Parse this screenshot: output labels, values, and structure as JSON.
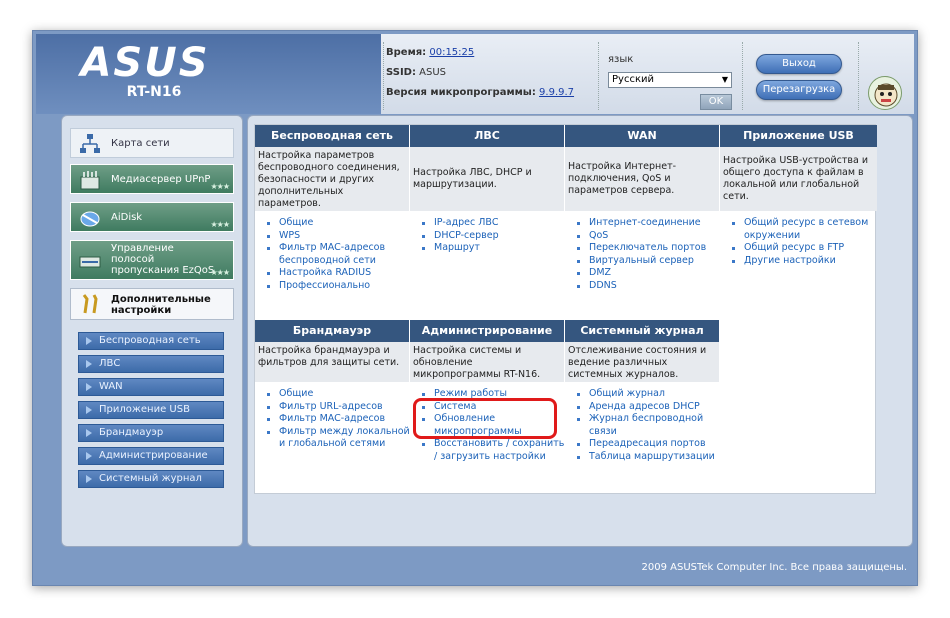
{
  "header": {
    "brand": "ASUS",
    "model": "RT-N16",
    "time_label": "Время:",
    "time_value": "00:15:25",
    "ssid_label": "SSID:",
    "ssid_value": "ASUS",
    "firmware_label": "Версия микропрограммы:",
    "firmware_value": "9.9.9.7",
    "lang_label": "язык",
    "lang_selected": "Русский",
    "ok_label": "OK",
    "logout_label": "Выход",
    "reboot_label": "Перезагрузка"
  },
  "sidebar": {
    "main_items": [
      {
        "label": "Карта сети",
        "icon": "network-map-icon"
      },
      {
        "label": "Медиасервер UPnP",
        "icon": "media-server-icon"
      },
      {
        "label": "AiDisk",
        "icon": "aidisk-icon"
      },
      {
        "label": "Управление полосой пропускания EzQoS",
        "line1": "Управление",
        "line2": "полосой",
        "line3": "пропускания EzQoS",
        "icon": "ezqos-icon"
      },
      {
        "label": "Дополнительные настройки",
        "line1": "Дополнительные",
        "line2": "настройки",
        "icon": "tools-icon"
      }
    ],
    "sub_items": [
      "Беспроводная сеть",
      "ЛВС",
      "WAN",
      "Приложение USB",
      "Брандмауэр",
      "Администрирование",
      "Системный журнал"
    ]
  },
  "sections": [
    {
      "title": "Беспроводная сеть",
      "desc": "Настройка параметров беспроводного соединения, безопасности и других дополнительных параметров.",
      "links": [
        "Общие",
        "WPS",
        "Фильтр MAC-адресов беспроводной сети",
        "Настройка RADIUS",
        "Профессионально"
      ]
    },
    {
      "title": "ЛВС",
      "desc": "Настройка ЛВС, DHCP и маршрутизации.",
      "links": [
        "IP-адрес ЛВС",
        "DHCP-сервер",
        "Маршрут"
      ]
    },
    {
      "title": "WAN",
      "desc": "Настройка Интернет-подключения, QoS и параметров сервера.",
      "links": [
        "Интернет-соединение",
        "QoS",
        "Переключатель портов",
        "Виртуальный сервер",
        "DMZ",
        "DDNS"
      ]
    },
    {
      "title": "Приложение USB",
      "desc": "Настройка USB-устройства и общего доступа к файлам в локальной или глобальной сети.",
      "links": [
        "Общий ресурс в сетевом окружении",
        "Общий ресурс в FTP",
        "Другие настройки"
      ]
    },
    {
      "title": "Брандмауэр",
      "desc": "Настройка брандмауэра и фильтров для защиты сети.",
      "links": [
        "Общие",
        "Фильтр URL-адресов",
        "Фильтр MAC-адресов",
        "Фильтр между локальной и глобальной сетями"
      ]
    },
    {
      "title": "Администрирование",
      "desc": "Настройка системы и обновление микропрограммы RT-N16.",
      "links": [
        "Режим работы",
        "Система",
        "Обновление микропрограммы",
        "Восстановить / сохранить / загрузить настройки"
      ]
    },
    {
      "title": "Системный журнал",
      "desc": "Отслеживание состояния и ведение различных системных журналов.",
      "links": [
        "Общий журнал",
        "Аренда адресов DHCP",
        "Журнал беспроводной связи",
        "Переадресация портов",
        "Таблица маршрутизации"
      ]
    }
  ],
  "footer": "2009 ASUSTek Computer Inc. Все права защищены.",
  "colors": {
    "accent": "#35567f",
    "link": "#1c62b8",
    "highlight": "#e01a1a"
  }
}
